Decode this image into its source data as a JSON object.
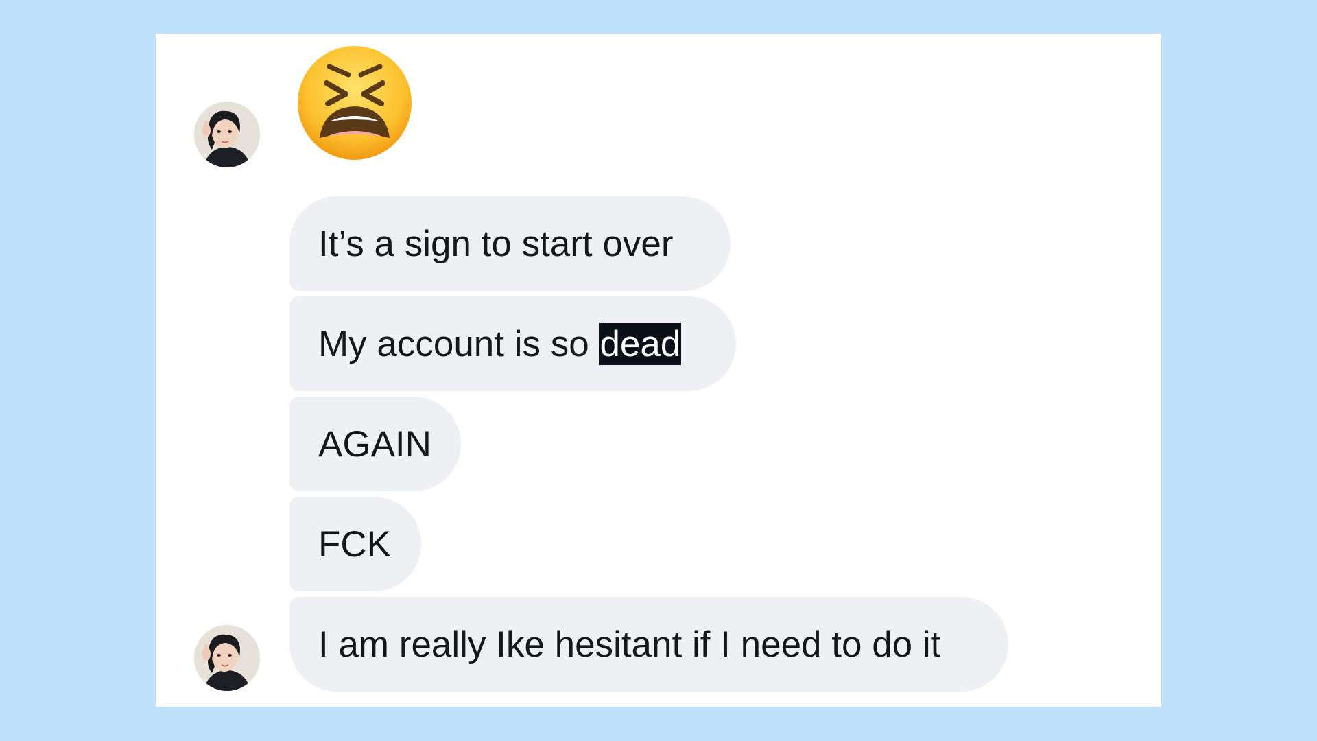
{
  "conversation": {
    "messages": [
      {
        "text": "It’s a sign to start over"
      },
      {
        "text_before_selection": "My account is so ",
        "selected_text": "dead"
      },
      {
        "text": "AGAIN"
      },
      {
        "text": "FCK"
      },
      {
        "text": "I am really Ike hesitant if I need to do it"
      }
    ]
  },
  "emoji": {
    "icon": "tired-face-emoji-icon"
  },
  "avatar": {
    "icon": "user-avatar-photo"
  },
  "colors": {
    "background": "#bde0fc",
    "card": "#ffffff",
    "bubble": "#eef0f3",
    "text": "#14171a",
    "selection": "#0a0f19"
  }
}
